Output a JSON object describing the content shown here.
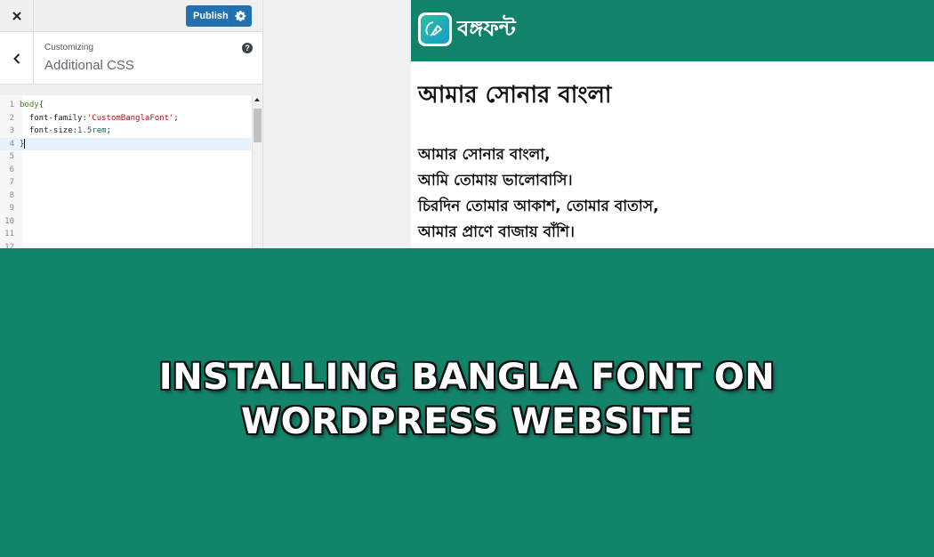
{
  "customizer": {
    "close_icon": "close-icon",
    "publish_label": "Publish",
    "settings_icon": "gear-icon",
    "back_icon": "chevron-left-icon",
    "breadcrumb": "Customizing",
    "section_title": "Additional CSS",
    "help_icon": "question-mark-icon",
    "help_glyph": "?",
    "accent_color": "#2271b1"
  },
  "code_editor": {
    "lines": [
      {
        "num": "1",
        "selector": "body",
        "brace": "{"
      },
      {
        "num": "2",
        "property": "font-family:",
        "string": "'CustomBanglaFont'",
        "end": ";"
      },
      {
        "num": "3",
        "property": "font-size:",
        "number": "1.5rem",
        "end": ";"
      },
      {
        "num": "4",
        "brace": "}"
      },
      {
        "num": "5"
      },
      {
        "num": "6"
      },
      {
        "num": "7"
      },
      {
        "num": "8"
      },
      {
        "num": "9"
      },
      {
        "num": "10"
      },
      {
        "num": "11"
      },
      {
        "num": "12"
      }
    ],
    "active_line": 4
  },
  "preview": {
    "logo_icon": "pen-nib-icon",
    "site_name": "বঙ্গফন্ট",
    "post_title": "আমার সোনার বাংলা",
    "poem_lines": [
      "আমার সোনার বাংলা,",
      "আমি তোমায় ভালোবাসি।",
      "চিরদিন তোমার আকাশ, তোমার বাতাস,",
      "আমার প্রাণে বাজায় বাঁশি।"
    ],
    "header_color": "#13826a"
  },
  "banner": {
    "headline_line1": "INSTALLING BANGLA FONT ON",
    "headline_line2": "WORDPRESS WEBSITE",
    "background_color": "#12846a"
  }
}
